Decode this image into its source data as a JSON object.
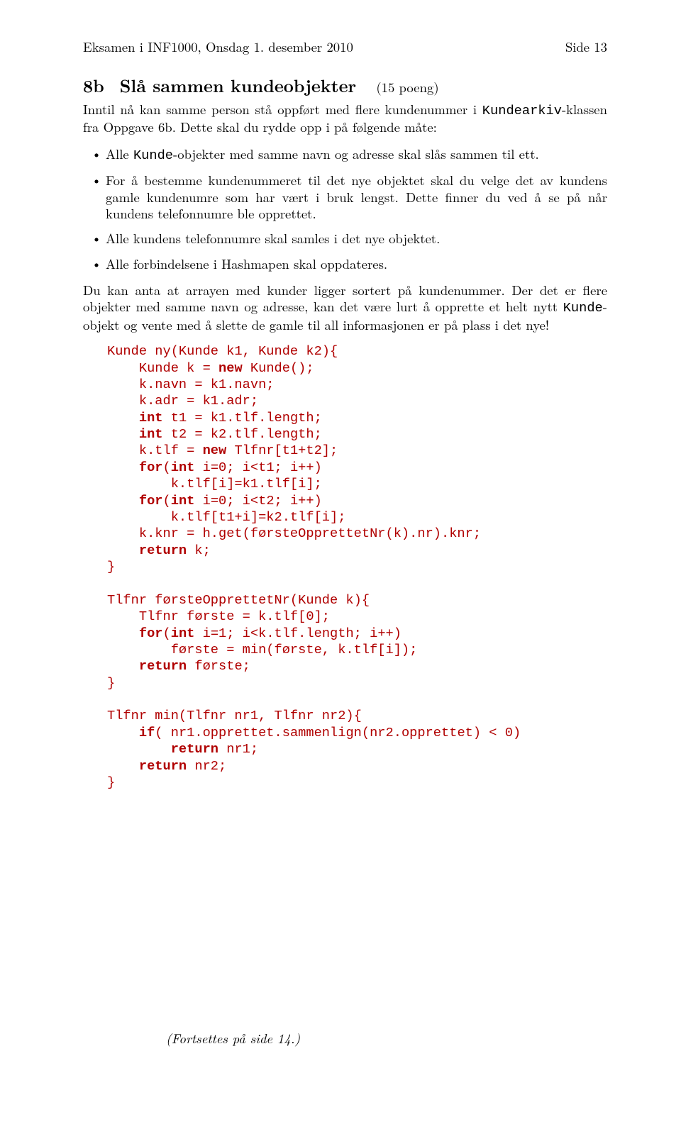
{
  "header": {
    "left": "Eksamen i INF1000, Onsdag 1. desember 2010",
    "right": "Side 13"
  },
  "section": {
    "number": "8b",
    "title": "Slå sammen kundeobjekter",
    "points": "(15 poeng)"
  },
  "intro": {
    "p1a": "Inntil nå kan samme person stå oppført med flere kundenummer i ",
    "p1b": "Kundearkiv",
    "p1c": "-klassen fra Oppgave 6b. Dette skal du rydde opp i på følgende måte:"
  },
  "bullets": {
    "b1a": "Alle ",
    "b1b": "Kunde",
    "b1c": "-objekter med samme navn og adresse skal slås sammen til ett.",
    "b2": "For å bestemme kundenummeret til det nye objektet skal du velge det av kundens gamle kundenumre som har vært i bruk lengst. Dette finner du ved å se på når kundens telefonnumre ble opprettet.",
    "b3": "Alle kundens telefonnumre skal samles i det nye objektet.",
    "b4": "Alle forbindelsene i Hashmapen skal oppdateres."
  },
  "after": {
    "p2a": "Du kan anta at arrayen med kunder ligger sortert på kundenummer. Der det er flere objekter med samme navn og adresse, kan det være lurt å opprette et helt nytt ",
    "p2b": "Kunde",
    "p2c": "-objekt og vente med å slette de gamle til all informasjonen er på plass i det nye!"
  },
  "code": {
    "l01a": "Kunde ny(Kunde k1, Kunde k2){",
    "l02a": "    Kunde k = ",
    "l02k": "new",
    "l02b": " Kunde();",
    "l03": "    k.navn = k1.navn;",
    "l04": "    k.adr = k1.adr;",
    "l05a": "    ",
    "l05k": "int",
    "l05b": " t1 = k1.tlf.length;",
    "l06a": "    ",
    "l06k": "int",
    "l06b": " t2 = k2.tlf.length;",
    "l07a": "    k.tlf = ",
    "l07k": "new",
    "l07b": " Tlfnr[t1+t2];",
    "l08a": "    ",
    "l08k": "for",
    "l08b": "(",
    "l08k2": "int",
    "l08c": " i=0; i<t1; i++)",
    "l09": "        k.tlf[i]=k1.tlf[i];",
    "l10a": "    ",
    "l10k": "for",
    "l10b": "(",
    "l10k2": "int",
    "l10c": " i=0; i<t2; i++)",
    "l11": "        k.tlf[t1+i]=k2.tlf[i];",
    "l12": "    k.knr = h.get(førsteOpprettetNr(k).nr).knr;",
    "l13a": "    ",
    "l13k": "return",
    "l13b": " k;",
    "l14": "}",
    "blk": "",
    "l15": "Tlfnr førsteOpprettetNr(Kunde k){",
    "l16": "    Tlfnr første = k.tlf[0];",
    "l17a": "    ",
    "l17k": "for",
    "l17b": "(",
    "l17k2": "int",
    "l17c": " i=1; i<k.tlf.length; i++)",
    "l18": "        første = min(første, k.tlf[i]);",
    "l19a": "    ",
    "l19k": "return",
    "l19b": " første;",
    "l20": "}",
    "l21": "Tlfnr min(Tlfnr nr1, Tlfnr nr2){",
    "l22a": "    ",
    "l22k": "if",
    "l22b": "( nr1.opprettet.sammenlign(nr2.opprettet) < 0)",
    "l23a": "        ",
    "l23k": "return",
    "l23b": " nr1;",
    "l24a": "    ",
    "l24k": "return",
    "l24b": " nr2;",
    "l25": "}"
  },
  "continue": "(Fortsettes på side 14.)"
}
